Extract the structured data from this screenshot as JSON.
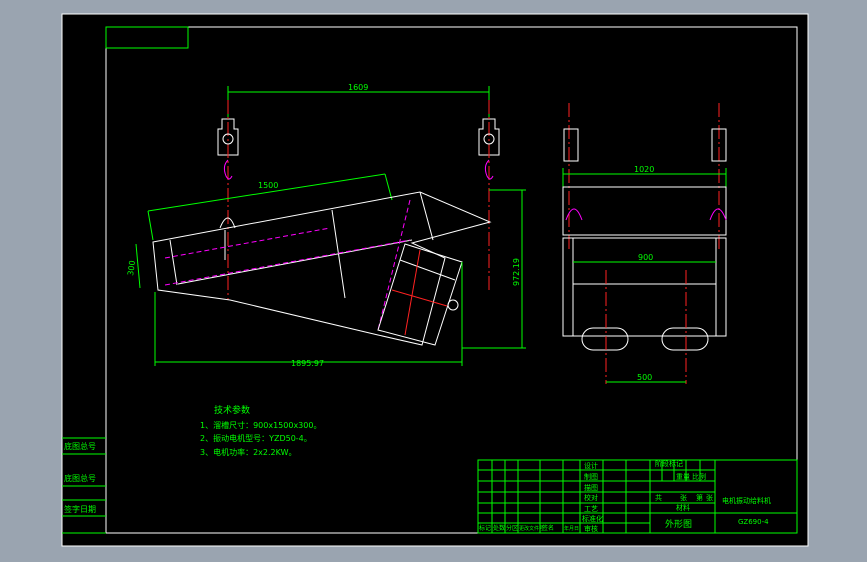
{
  "colors": {
    "chrome": "#9aa4b0",
    "background": "#000000",
    "border": "#ffffff",
    "outline": "#ffffff",
    "dimension": "#00ff00",
    "centerline": "#ff2020",
    "hidden": "#ff00ff",
    "note_text": "#00ff00",
    "titleblock": "#00ff00"
  },
  "front_view": {
    "dim_hanger_span": "1609",
    "dim_trough_length": "1500",
    "dim_trough_depth": "300",
    "dim_overall_length": "1895.97",
    "dim_height": "972.19"
  },
  "side_view": {
    "dim_width_outer": "1020",
    "dim_width_inner": "900",
    "dim_motor_span": "500"
  },
  "notes": {
    "heading": "技术参数",
    "items": [
      "1、溜槽尺寸：900x1500x300。",
      "2、振动电机型号：YZD50-4。",
      "3、电机功率：2x2.2KW。"
    ]
  },
  "side_labels": [
    "底图总号",
    "底图总号",
    "签字日期"
  ],
  "title_block": {
    "rows_left": [
      "设计",
      "制图",
      "描图",
      "校对",
      "工艺",
      "标准化",
      "审核"
    ],
    "sign_cells": [
      "阶段标记",
      "重量",
      "比例"
    ],
    "bottom_cells": [
      "标记",
      "处数",
      "分区",
      "更改文件号",
      "签名",
      "年月日"
    ],
    "sheet_cells": [
      "共",
      "张",
      "第",
      "张"
    ],
    "material": "材料",
    "drawing_name": "外形图",
    "product_name": "电机振动给料机",
    "drawing_number": "GZ690-4"
  }
}
